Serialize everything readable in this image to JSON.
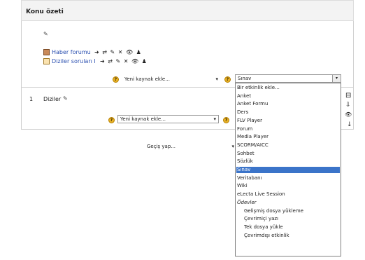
{
  "header": {
    "title": "Konu özeti"
  },
  "section0": {
    "edit_glyph": "✎",
    "activities": [
      {
        "label": "Haber forumu",
        "controls": "➜ ⇄ ✎ ✕ 👁 ♟"
      },
      {
        "label": "Diziler soruları I",
        "controls": "➜ ⇄ ✎ ✕ 👁 ♟"
      }
    ],
    "add_resource": {
      "value": "Yeni kaynak ekle...",
      "arrow": "▾"
    },
    "add_activity": {
      "value": "Sınav",
      "arrow": "▾"
    }
  },
  "section1": {
    "number": "1",
    "name": "Diziler",
    "edit_glyph": "✎",
    "add_resource": {
      "value": "Yeni kaynak ekle...",
      "arrow": "▾"
    },
    "side_icons": {
      "highlight": "⊟",
      "move": "⇩",
      "show": "👁",
      "down": "↓"
    }
  },
  "jump": {
    "value": "Geçiş yap...",
    "arrow": "▾"
  },
  "help_glyph": "?",
  "activity_options": [
    "Bir etkinlik ekle...",
    "Anket",
    "Anket Formu",
    "Ders",
    "FLV Player",
    "Forum",
    "Media Player",
    "SCORM/AICC",
    "Sohbet",
    "Sözlük",
    "Sınav",
    "Veritabanı",
    "Wiki",
    "eLecta Live Session",
    "Ödevler",
    "Gelişmiş dosya yükleme",
    "Çevrimiçi yazı",
    "Tek dosya yükle",
    "Çevrimdışı etkinlik"
  ],
  "selected_option": "Sınav",
  "group_option": "Ödevler",
  "colors": {
    "link": "#2a4fb0",
    "selection": "#3b74c9"
  }
}
